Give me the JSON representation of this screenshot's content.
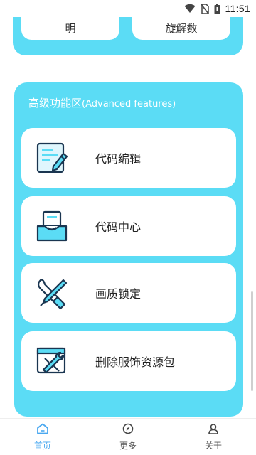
{
  "status_bar": {
    "time": "11:51",
    "icons": [
      "wifi-icon",
      "no-sim-icon",
      "battery-icon"
    ]
  },
  "top_section": {
    "left_card_label": "明",
    "right_card_label": "旋解数"
  },
  "advanced": {
    "title_cn": "高级功能区",
    "title_en": "(Advanced features)",
    "items": [
      {
        "label": "代码编辑",
        "icon": "code-edit-icon"
      },
      {
        "label": "代码中心",
        "icon": "code-center-icon"
      },
      {
        "label": "画质锁定",
        "icon": "quality-lock-icon"
      },
      {
        "label": "删除服饰资源包",
        "icon": "delete-resource-icon"
      }
    ]
  },
  "bottom_nav": {
    "items": [
      {
        "label": "首页",
        "icon": "home-icon",
        "active": true
      },
      {
        "label": "更多",
        "icon": "compass-icon",
        "active": false
      },
      {
        "label": "关于",
        "icon": "person-icon",
        "active": false
      }
    ]
  },
  "colors": {
    "panel": "#5bdcf5",
    "accent": "#4aa8f0",
    "icon_dark": "#1a3550"
  }
}
